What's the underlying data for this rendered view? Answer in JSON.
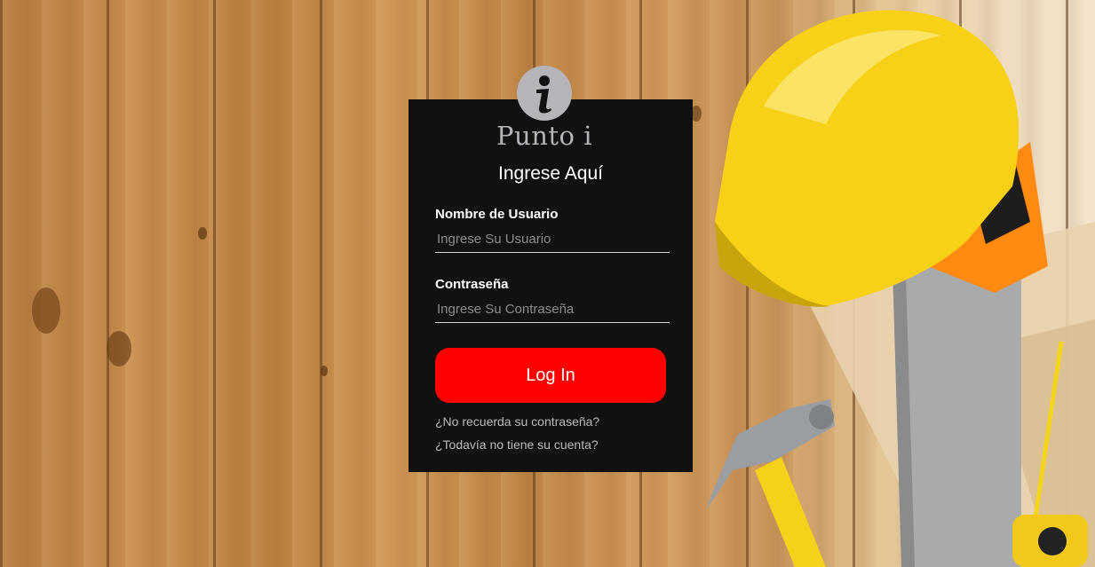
{
  "brand": {
    "logo_icon": "info-icon",
    "name": "Punto i"
  },
  "form": {
    "title": "Ingrese Aquí",
    "username": {
      "label": "Nombre de Usuario",
      "placeholder": "Ingrese Su Usuario",
      "value": ""
    },
    "password": {
      "label": "Contraseña",
      "placeholder": "Ingrese Su Contraseña",
      "value": ""
    },
    "submit_label": "Log In",
    "forgot_password_link": "¿No recuerda su contraseña?",
    "no_account_link": "¿Todavía no tiene su cuenta?"
  },
  "background": {
    "description_icons": [
      "hard-hat-icon",
      "saw-icon",
      "hammer-icon",
      "tape-measure-icon"
    ]
  },
  "colors": {
    "card_background": "#111111",
    "button": "#ff0000",
    "logo_badge": "#b6b4b8",
    "wood": "#c88e4f",
    "helmet": "#f7d117"
  }
}
